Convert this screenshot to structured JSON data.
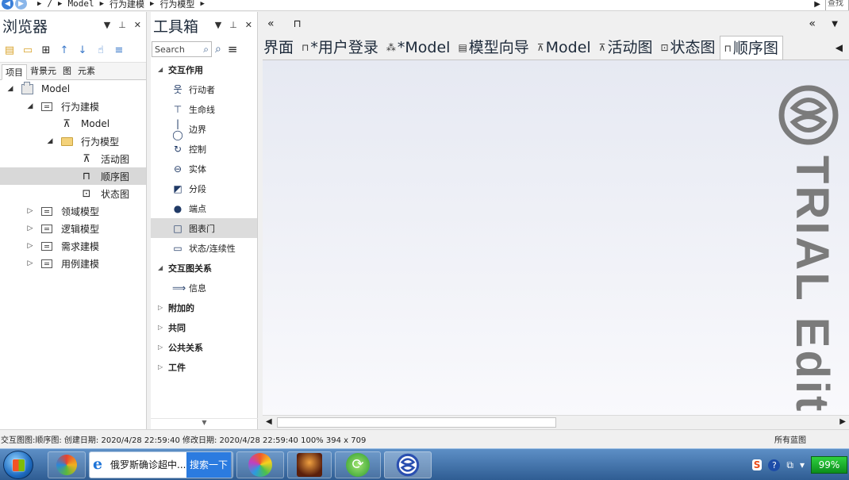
{
  "topbar": {
    "crumbs": [
      "/",
      "Model",
      "行为建模",
      "行为模型"
    ],
    "find_placeholder": "查找"
  },
  "browser": {
    "title": "浏览器",
    "tabs": [
      "项目",
      "背景元",
      "图",
      "元素"
    ],
    "tree": [
      {
        "label": "Model",
        "icon": "model-icon",
        "expander": "◢",
        "level": 0
      },
      {
        "label": "行为建模",
        "icon": "package-icon",
        "expander": "◢",
        "level": 1
      },
      {
        "label": "Model",
        "icon": "activity-diagram-icon",
        "expander": "",
        "level": 2
      },
      {
        "label": "行为模型",
        "icon": "folder-icon",
        "expander": "◢",
        "level": 2
      },
      {
        "label": "活动图",
        "icon": "activity-diagram-icon",
        "expander": "",
        "level": 3
      },
      {
        "label": "顺序图",
        "icon": "sequence-diagram-icon",
        "expander": "",
        "level": 3,
        "selected": true
      },
      {
        "label": "状态图",
        "icon": "state-diagram-icon",
        "expander": "",
        "level": 3
      },
      {
        "label": "领域模型",
        "icon": "package-icon",
        "expander": "▷",
        "level": 1
      },
      {
        "label": "逻辑模型",
        "icon": "package-icon",
        "expander": "▷",
        "level": 1
      },
      {
        "label": "需求建模",
        "icon": "package-icon",
        "expander": "▷",
        "level": 1
      },
      {
        "label": "用例建模",
        "icon": "package-icon",
        "expander": "▷",
        "level": 1
      }
    ]
  },
  "toolbox": {
    "title": "工具箱",
    "search_placeholder": "Search",
    "sections": [
      {
        "label": "交互作用",
        "expanded": true,
        "items": [
          {
            "label": "行动者",
            "icon": "actor-icon"
          },
          {
            "label": "生命线",
            "icon": "lifeline-icon"
          },
          {
            "label": "边界",
            "icon": "boundary-icon"
          },
          {
            "label": "控制",
            "icon": "control-icon"
          },
          {
            "label": "实体",
            "icon": "entity-icon"
          },
          {
            "label": "分段",
            "icon": "fragment-icon"
          },
          {
            "label": "端点",
            "icon": "endpoint-icon"
          },
          {
            "label": "图表门",
            "icon": "diagram-gate-icon",
            "hover": true
          },
          {
            "label": "状态/连续性",
            "icon": "state-continuation-icon"
          }
        ]
      },
      {
        "label": "交互图关系",
        "expanded": true,
        "items": [
          {
            "label": "信息",
            "icon": "message-arrow-icon"
          }
        ]
      },
      {
        "label": "附加的",
        "expanded": false,
        "items": []
      },
      {
        "label": "共同",
        "expanded": false,
        "items": []
      },
      {
        "label": "公共关系",
        "expanded": false,
        "items": []
      },
      {
        "label": "工件",
        "expanded": false,
        "items": []
      }
    ]
  },
  "diagram": {
    "tabs": [
      {
        "label": "界面",
        "icon": ""
      },
      {
        "label": "*用户登录",
        "icon": "sequence-diagram-icon"
      },
      {
        "label": "*Model",
        "icon": "usecase-diagram-icon"
      },
      {
        "label": "模型向导",
        "icon": "wizard-icon"
      },
      {
        "label": "Model",
        "icon": "activity-diagram-icon"
      },
      {
        "label": "活动图",
        "icon": "activity-diagram-icon"
      },
      {
        "label": "状态图",
        "icon": "state-diagram-icon"
      },
      {
        "label": "顺序图",
        "icon": "sequence-diagram-icon",
        "active": true
      }
    ],
    "watermark": "TRIAL Editi"
  },
  "statusbar": {
    "left": "交互图图:顺序图:   创建日期: 2020/4/28 22:59:40  修改日期: 2020/4/28 22:59:40  100%   394 x 709",
    "right": "所有蓝图"
  },
  "taskbar": {
    "ie_label": "俄罗斯确诊超中...",
    "search_label": "搜索一下",
    "battery": "99%"
  },
  "colors": {
    "accent": "#2b7be0",
    "selected_row": "#d8d8d8",
    "canvas_top": "#e6e9f2",
    "watermark": "#7b7b7b"
  }
}
